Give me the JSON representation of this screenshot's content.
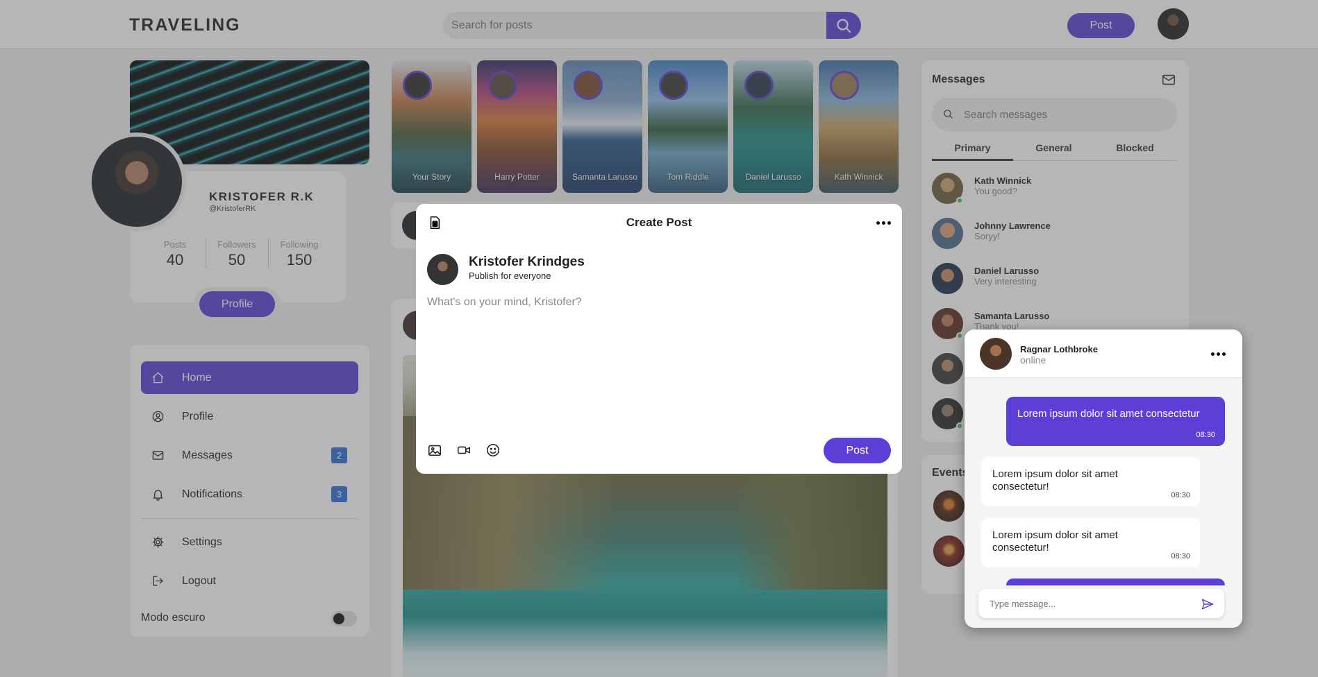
{
  "header": {
    "logo": "TRAVELING",
    "search_placeholder": "Search for posts",
    "post_label": "Post"
  },
  "profile": {
    "name": "KRISTOFER R.K",
    "handle": "@KristoferRK",
    "stats": [
      {
        "label": "Posts",
        "value": "40"
      },
      {
        "label": "Followers",
        "value": "50"
      },
      {
        "label": "Following",
        "value": "150"
      }
    ],
    "button_label": "Profile"
  },
  "nav": {
    "items": [
      {
        "label": "Home",
        "icon": "home-icon",
        "active": true
      },
      {
        "label": "Profile",
        "icon": "user-circle-icon"
      },
      {
        "label": "Messages",
        "icon": "mail-icon",
        "badge": "2"
      },
      {
        "label": "Notifications",
        "icon": "bell-icon",
        "badge": "3"
      },
      {
        "label": "Settings",
        "icon": "gear-icon"
      },
      {
        "label": "Logout",
        "icon": "logout-icon"
      }
    ],
    "dark_mode_label": "Modo escuro",
    "dark_mode_on": false
  },
  "stories": [
    {
      "name": "Your Story"
    },
    {
      "name": "Harry Potter"
    },
    {
      "name": "Samanta Larusso"
    },
    {
      "name": "Tom Riddle"
    },
    {
      "name": "Daniel Larusso"
    },
    {
      "name": "Kath Winnick"
    }
  ],
  "messages": {
    "title": "Messages",
    "search_placeholder": "Search messages",
    "tabs": [
      "Primary",
      "General",
      "Blocked"
    ],
    "active_tab": "Primary",
    "conversations": [
      {
        "name": "Kath Winnick",
        "preview": "You good?",
        "online": true
      },
      {
        "name": "Johnny Lawrence",
        "preview": "Soryy!",
        "online": false
      },
      {
        "name": "Daniel Larusso",
        "preview": "Very interesting",
        "online": false
      },
      {
        "name": "Samanta Larusso",
        "preview": "Thank you!",
        "online": true
      }
    ]
  },
  "events": {
    "title": "Events"
  },
  "modal": {
    "title": "Create Post",
    "author_name": "Kristofer Krindges",
    "audience": "Publish for everyone",
    "placeholder": "What's on your mind, Kristofer?",
    "post_label": "Post"
  },
  "chat": {
    "name": "Ragnar Lothbroke",
    "status": "online",
    "messages": [
      {
        "direction": "out",
        "text": "Lorem ipsum dolor sit amet consectetur",
        "time": "08:30"
      },
      {
        "direction": "in",
        "text": "Lorem ipsum dolor sit amet consectetur!",
        "time": "08:30"
      },
      {
        "direction": "in",
        "text": "Lorem ipsum dolor sit amet consectetur!",
        "time": "08:30"
      }
    ],
    "input_placeholder": "Type message..."
  },
  "colors": {
    "accent": "#5b3fd6",
    "badge": "#2b6fd6",
    "online": "#3cc25b"
  }
}
